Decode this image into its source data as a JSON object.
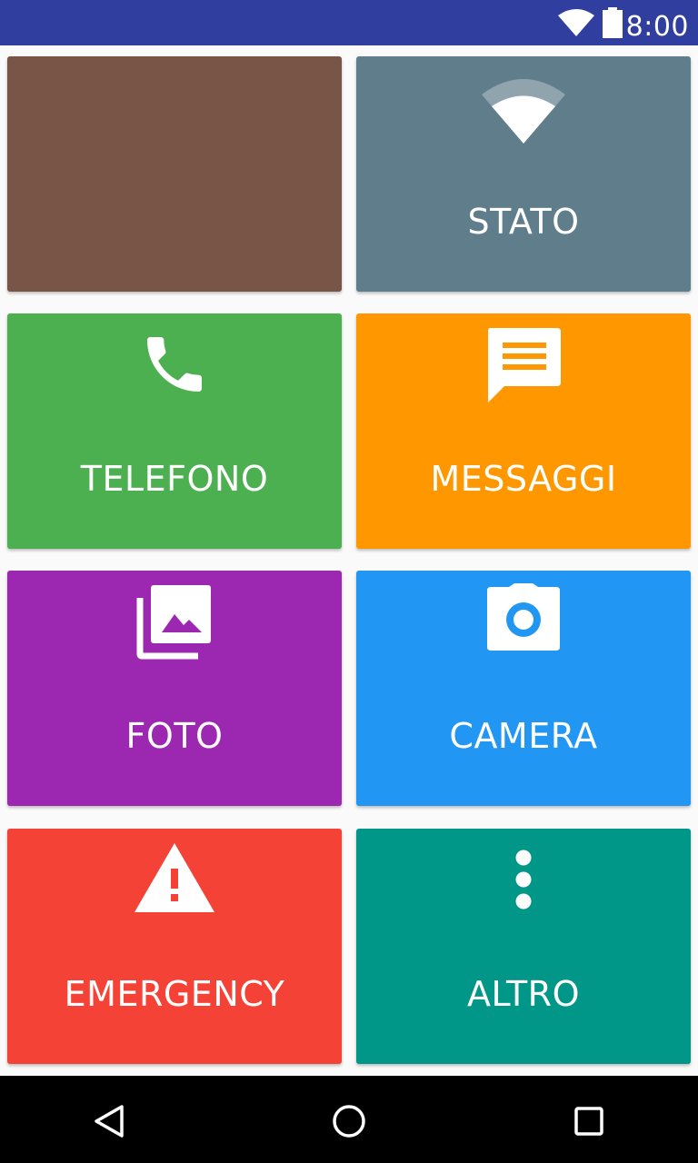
{
  "status_bar": {
    "time": "8:00",
    "icons": [
      "wifi-icon",
      "battery-icon"
    ],
    "background": "#303f9f"
  },
  "tiles": [
    {
      "label": "",
      "color": "#795548",
      "icon": ""
    },
    {
      "label": "STATO",
      "color": "#607d8b",
      "icon": "wifi-icon"
    },
    {
      "label": "TELEFONO",
      "color": "#4caf50",
      "icon": "phone-icon"
    },
    {
      "label": "MESSAGGI",
      "color": "#ff9800",
      "icon": "message-icon"
    },
    {
      "label": "FOTO",
      "color": "#9c27b0",
      "icon": "photo-library-icon"
    },
    {
      "label": "CAMERA",
      "color": "#2196f3",
      "icon": "camera-icon"
    },
    {
      "label": "EMERGENCY",
      "color": "#f44336",
      "icon": "warning-icon"
    },
    {
      "label": "ALTRO",
      "color": "#009688",
      "icon": "more-vert-icon"
    }
  ],
  "nav_bar": {
    "buttons": [
      "back-icon",
      "home-icon",
      "recents-icon"
    ]
  }
}
